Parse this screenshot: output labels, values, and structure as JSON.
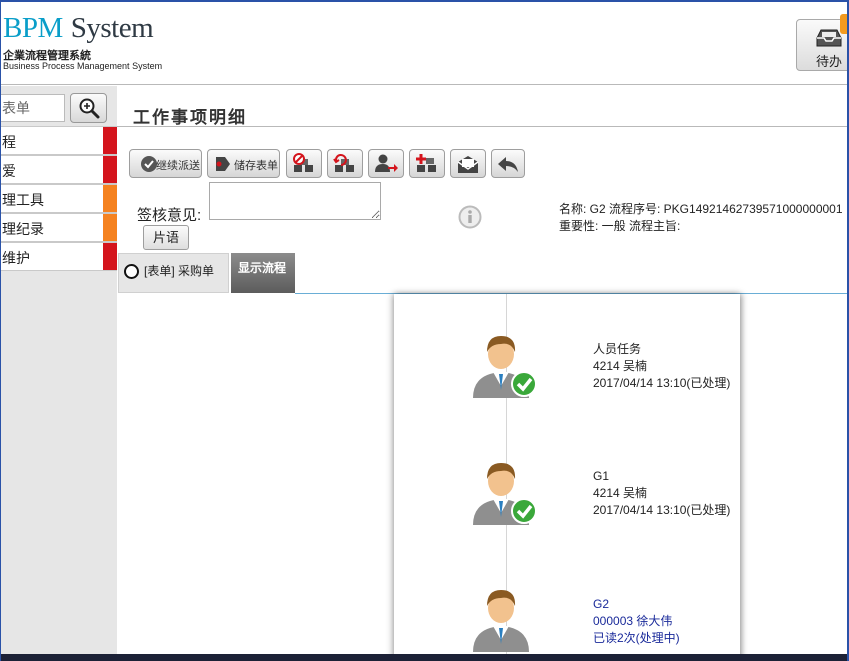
{
  "header": {
    "logo_main": "BPM",
    "logo_system": "System",
    "logo_cn": "企業流程管理系統",
    "logo_en": "Business Process Management System",
    "todo_label": "待办",
    "todo_icon": "inbox-tray-icon"
  },
  "sidebar": {
    "search_value": "表单",
    "search_icon": "magnifier-icon",
    "items": [
      {
        "label": "程",
        "bar_color": "#d4141c"
      },
      {
        "label": "爱",
        "bar_color": "#d4141c"
      },
      {
        "label": "理工具",
        "bar_color": "#f58220"
      },
      {
        "label": "理纪录",
        "bar_color": "#f58220"
      },
      {
        "label": "维护",
        "bar_color": "#d4141c"
      }
    ]
  },
  "page": {
    "title": "工作事项明细"
  },
  "toolbar": {
    "continue_label": "继续派送",
    "save_label": "储存表单"
  },
  "sign": {
    "label": "签核意见:",
    "value": "",
    "phrase_button": "片语"
  },
  "meta": {
    "line1": "名称: G2  流程序号: PKG14921462739571000000001",
    "line2": "重要性: 一般 流程主旨:"
  },
  "tabs": {
    "form_tab": "[表单] 采购单",
    "flow_tab": "显示流程"
  },
  "flow": {
    "nodes": [
      {
        "name": "人员任务",
        "user": "4214  吴楠",
        "status": "2017/04/14 13:10(已处理)",
        "state": "done"
      },
      {
        "name": "G1",
        "user": "4214  吴楠",
        "status": "2017/04/14 13:10(已处理)",
        "state": "done"
      },
      {
        "name": "G2",
        "user": "000003  徐大伟",
        "status": "已读2次(处理中)",
        "state": "pending"
      }
    ]
  },
  "colors": {
    "accent_blue": "#0a9ec9",
    "red_bar": "#d4141c",
    "orange_bar": "#f58220",
    "pending_text": "#1a2a9a"
  }
}
